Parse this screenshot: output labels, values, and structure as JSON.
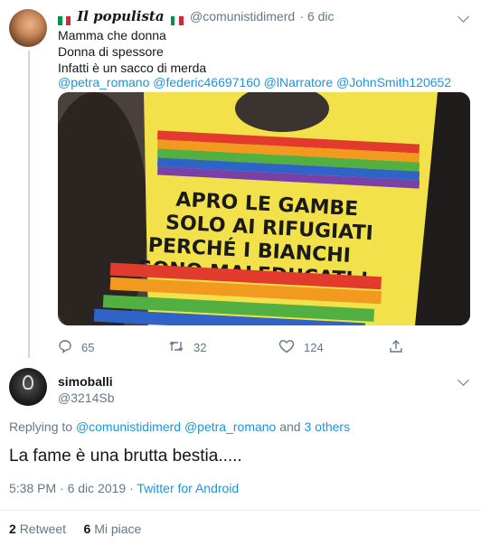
{
  "tweet1": {
    "display_name": "Il populista",
    "handle": "@comunistidimerd",
    "date": "6 dic",
    "lines": [
      "Mamma che donna",
      "Donna di spessore",
      "Infatti è un sacco di merda"
    ],
    "mentions": "@petra_romano @federic46697160 @lNarratore @JohnSmith120652",
    "image_text": [
      "APRO LE GAMBE",
      "SOLO AI RIFUGIATI",
      "PERCHÉ  I BIANCHI",
      "SONO MALEDUCATI !"
    ],
    "replies_count": "65",
    "retweets_count": "32",
    "likes_count": "124"
  },
  "tweet2": {
    "display_name": "simoballi",
    "handle": "@3214Sb",
    "replying_label": "Replying to",
    "replying_to": "@comunistidimerd @petra_romano",
    "replying_and": "and",
    "replying_others": "3 others",
    "text": "La fame è una brutta bestia.....",
    "time": "5:38 PM · 6 dic 2019 ·",
    "source": "Twitter for Android",
    "retweets_num": "2",
    "retweets_label": "Retweet",
    "likes_num": "6",
    "likes_label": "Mi piace"
  },
  "colors": {
    "accent": "#1b95e0",
    "secondary_text": "#657786",
    "separator": "#e6ecf0",
    "sign_yellow": "#f2e14a"
  },
  "icons": [
    "avatar",
    "italy-flag-icon",
    "chevron-down-icon",
    "reply-icon",
    "retweet-icon",
    "like-icon",
    "share-icon"
  ]
}
